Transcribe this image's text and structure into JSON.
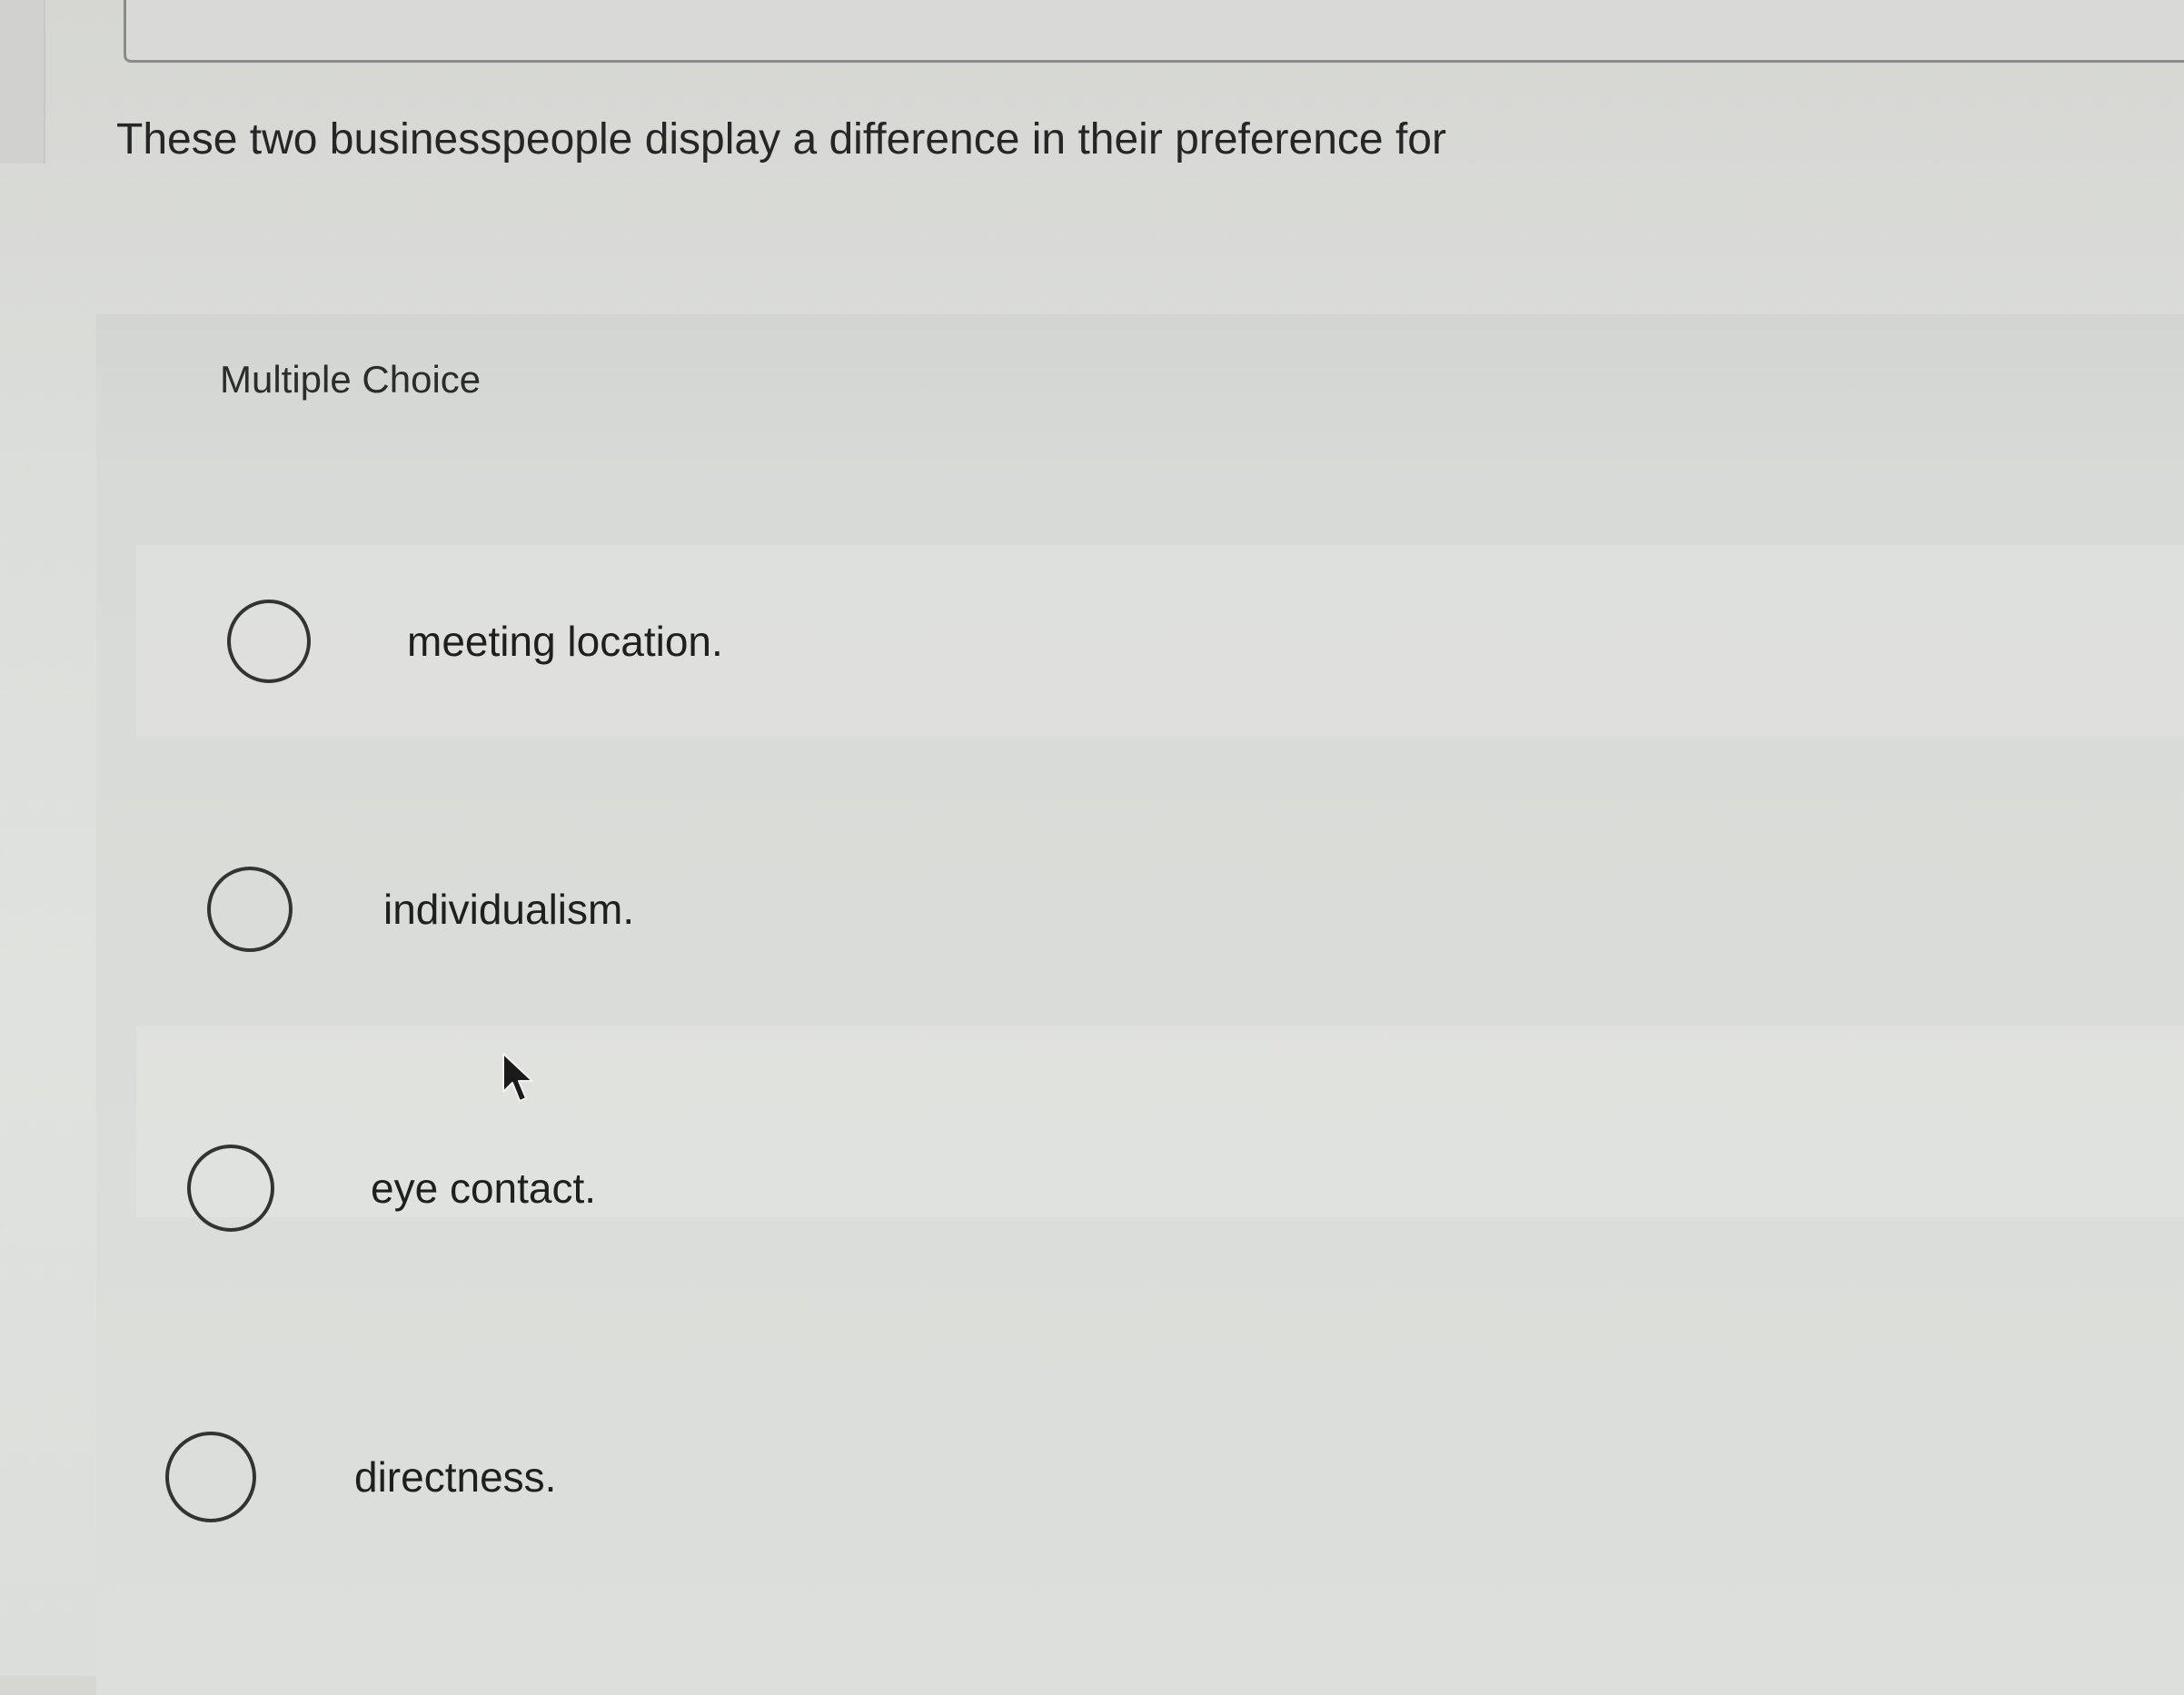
{
  "question": {
    "text": "These two businesspeople display a difference in their preference for"
  },
  "multiple_choice": {
    "header": "Multiple Choice",
    "options": [
      {
        "label": "meeting location.",
        "selected": false
      },
      {
        "label": "individualism.",
        "selected": false
      },
      {
        "label": "eye contact.",
        "selected": false
      },
      {
        "label": "directness.",
        "selected": false
      }
    ]
  },
  "icons": {
    "radio": "radio-button-unselected-icon",
    "cursor": "mouse-pointer-icon"
  }
}
